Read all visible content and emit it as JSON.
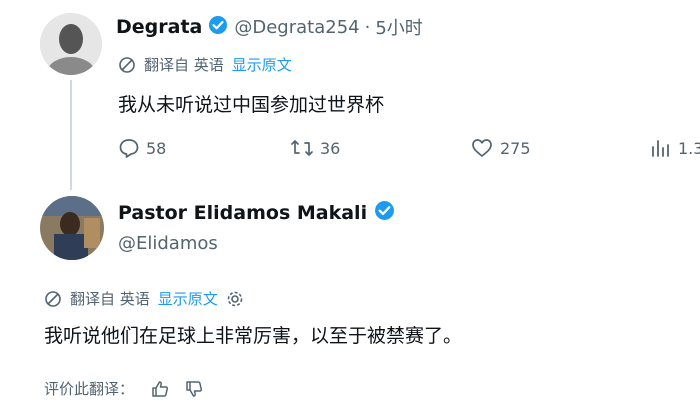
{
  "tweet1": {
    "display_name": "Degrata",
    "handle": "@Degrata254",
    "separator": "·",
    "time": "5小时",
    "translated_from": "翻译自 英语",
    "show_original": "显示原文",
    "text": "我从未听说过中国参加过世界杯",
    "replies": "58",
    "retweets": "36",
    "likes": "275",
    "views": "1.3"
  },
  "tweet2": {
    "display_name": "Pastor Elidamos Makali",
    "handle": "@Elidamos",
    "translated_from": "翻译自 英语",
    "show_original": "显示原文",
    "text": "我听说他们在足球上非常厉害，以至于被禁赛了。",
    "rate_translation": "评价此翻译："
  },
  "colors": {
    "accent": "#1d9bf0",
    "secondary_text": "#536471",
    "verified": "#1d9bf0"
  },
  "icons": [
    "translate-icon",
    "verified-badge-icon",
    "reply-icon",
    "retweet-icon",
    "like-icon",
    "views-icon",
    "gear-icon",
    "thumbs-up-icon",
    "thumbs-down-icon"
  ]
}
